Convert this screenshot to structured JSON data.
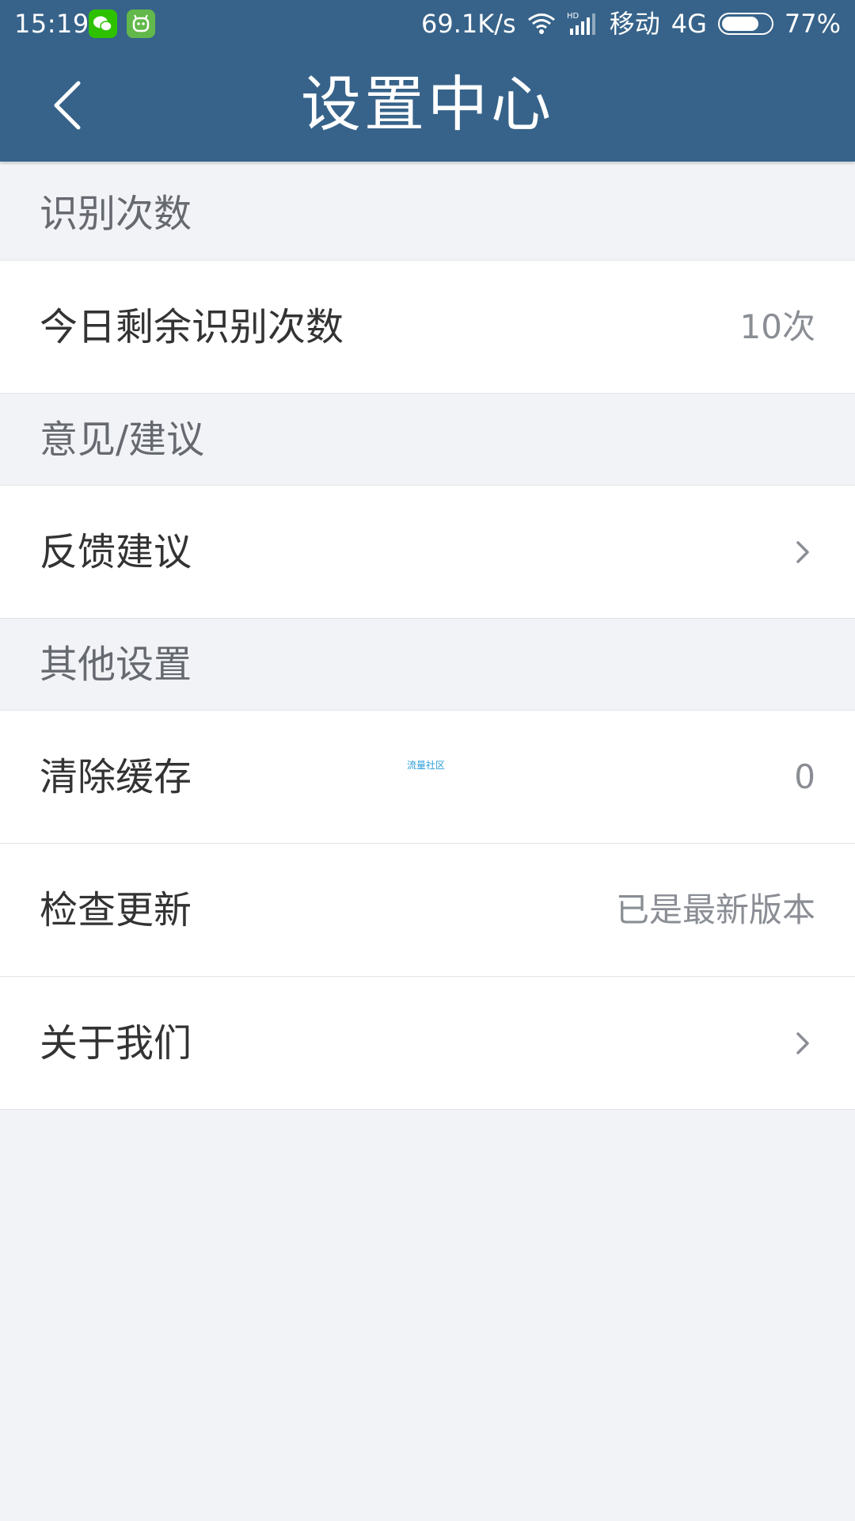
{
  "status_bar": {
    "time": "15:19",
    "net_speed": "69.1K/s",
    "hd": "HD",
    "carrier": "移动",
    "network": "4G",
    "battery_percent": "77%",
    "battery_level": 0.77,
    "icons": [
      "wechat-icon",
      "robot-app-icon",
      "wifi-icon",
      "signal-icon",
      "battery-icon"
    ]
  },
  "header": {
    "title": "设置中心",
    "back_icon": "chevron-left-icon"
  },
  "sections": {
    "recognition": {
      "title": "识别次数",
      "rows": {
        "remaining": {
          "label": "今日剩余识别次数",
          "value": "10次"
        }
      }
    },
    "feedback": {
      "title": "意见/建议",
      "rows": {
        "feedback": {
          "label": "反馈建议",
          "icon": "chevron-right-icon"
        }
      }
    },
    "other": {
      "title": "其他设置",
      "rows": {
        "clear_cache": {
          "label": "清除缓存",
          "value": "0",
          "watermark": "流量社区"
        },
        "check_update": {
          "label": "检查更新",
          "value": "已是最新版本"
        },
        "about": {
          "label": "关于我们",
          "icon": "chevron-right-icon"
        }
      }
    }
  },
  "colors": {
    "header_bg": "#37638a",
    "page_bg": "#f2f3f6",
    "text_primary": "#333333",
    "text_secondary": "#8a8e94"
  }
}
